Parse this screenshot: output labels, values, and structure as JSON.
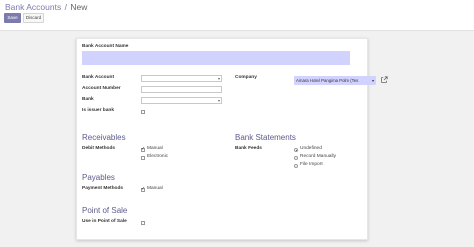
{
  "breadcrumb": {
    "parent": "Bank Accounts",
    "separator": "/",
    "current": "New"
  },
  "toolbar": {
    "save_label": "Save",
    "discard_label": "Discard"
  },
  "form": {
    "bank_account_name_label": "Bank Account Name",
    "bank_account_name_value": "",
    "account_label": "Bank Account",
    "account_number_label": "Account Number",
    "bank_label": "Bank",
    "is_issuer_bank_label": "Is issuer bank",
    "company_label": "Company",
    "company_value": "Amara Hotel Pangima Polm (Tes",
    "receivables_title": "Receivables",
    "debit_methods_label": "Debit Methods",
    "debit_methods": [
      {
        "label": "Manual",
        "checked": true
      },
      {
        "label": "Electronic",
        "checked": false
      }
    ],
    "payables_title": "Payables",
    "payment_methods_label": "Payment Methods",
    "payment_methods": [
      {
        "label": "Manual",
        "checked": true
      }
    ],
    "pos_title": "Point of Sale",
    "use_in_pos_label": "Use in Point of Sale",
    "bank_statements_title": "Bank Statements",
    "bank_feeds_label": "Bank Feeds",
    "bank_feeds_options": [
      {
        "label": "Undefined",
        "checked": true
      },
      {
        "label": "Record Manually",
        "checked": false
      },
      {
        "label": "File Import",
        "checked": false
      }
    ]
  },
  "colors": {
    "accent": "#7c7bad",
    "required_field": "#d2d2ff",
    "section_title": "#5c5b8d"
  },
  "icons": {
    "external_link": "external-link-icon",
    "dropdown": "chevron-down-icon"
  }
}
